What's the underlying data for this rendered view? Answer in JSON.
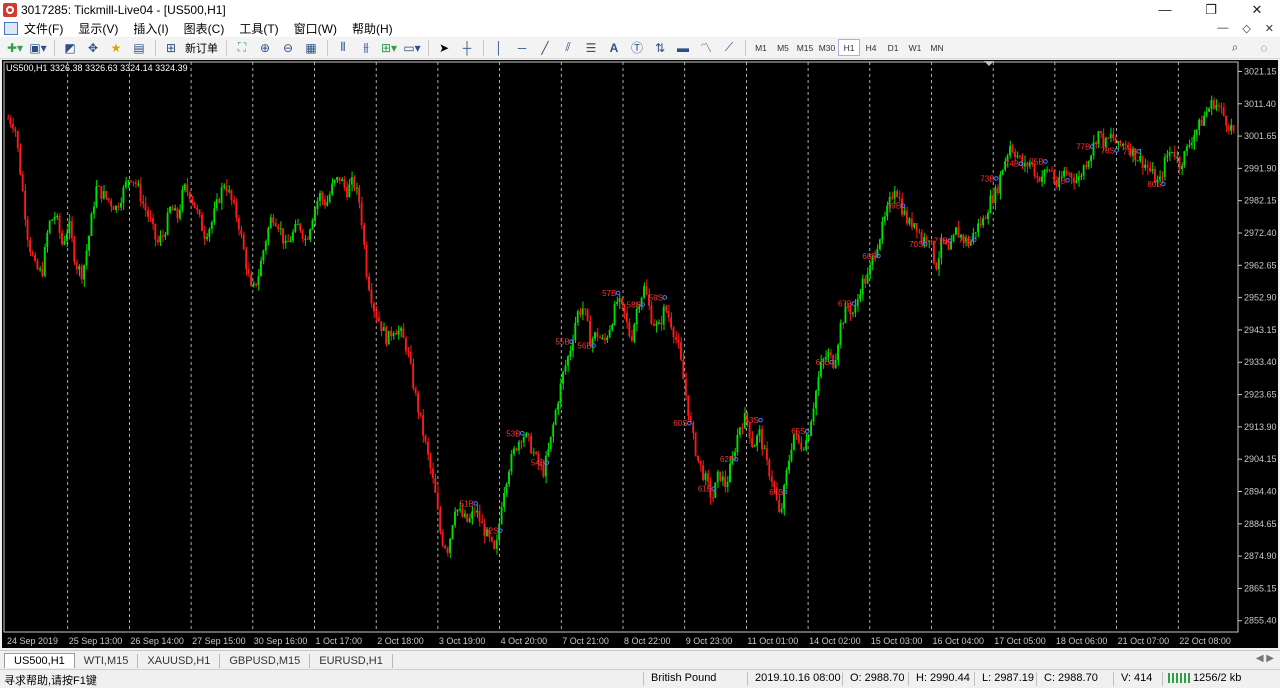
{
  "window": {
    "title": "3017285: Tickmill-Live04 - [US500,H1]",
    "controls": [
      "—",
      "❐",
      "✕"
    ]
  },
  "menu": {
    "items": [
      "文件(F)",
      "显示(V)",
      "插入(I)",
      "图表(C)",
      "工具(T)",
      "窗口(W)",
      "帮助(H)"
    ],
    "right": [
      "—",
      "◇",
      "✕"
    ]
  },
  "toolbar": {
    "new_order_label": "新订单",
    "timeframes": [
      "M1",
      "M5",
      "M15",
      "M30",
      "H1",
      "H4",
      "D1",
      "W1",
      "MN"
    ],
    "active_timeframe": "H1"
  },
  "chart": {
    "symbol_info": "US500,H1  3326.38 3326.63 3324.14 3324.39",
    "colors": {
      "up": "#00e000",
      "down": "#ff1a1a",
      "background": "#000000",
      "axis": "#c8c8c8",
      "marker_text": "#ff3030"
    },
    "price_levels": [
      "3021.15",
      "3011.40",
      "3001.65",
      "2991.90",
      "2982.15",
      "2972.40",
      "2962.65",
      "2952.90",
      "2943.15",
      "2933.40",
      "2923.65",
      "2913.90",
      "2904.15",
      "2894.40",
      "2884.65",
      "2874.90",
      "2865.15",
      "2855.40"
    ],
    "dates": [
      "24 Sep 2019",
      "25 Sep 13:00",
      "26 Sep 14:00",
      "27 Sep 15:00",
      "30 Sep 16:00",
      "1 Oct 17:00",
      "2 Oct 18:00",
      "3 Oct 19:00",
      "4 Oct 20:00",
      "7 Oct 21:00",
      "8 Oct 22:00",
      "9 Oct 23:00",
      "11 Oct 01:00",
      "14 Oct 02:00",
      "15 Oct 03:00",
      "16 Oct 04:00",
      "17 Oct 05:00",
      "18 Oct 06:00",
      "21 Oct 07:00",
      "22 Oct 08:00"
    ],
    "markers": [
      "51B",
      "52S",
      "53B",
      "54B",
      "55B",
      "56B",
      "57B",
      "58S",
      "59S",
      "60S",
      "61B",
      "62B",
      "63S",
      "64B",
      "65S",
      "66B",
      "67B",
      "68S",
      "69B",
      "70S",
      "71B",
      "72S",
      "73B",
      "74B",
      "75B",
      "76B",
      "77B",
      "78S",
      "79S",
      "80S"
    ],
    "series_path": [
      3007,
      3005,
      2988,
      2970,
      2962,
      2960,
      2975,
      2978,
      2969,
      2975,
      2963,
      2960,
      2972,
      2986,
      2984,
      2982,
      2980,
      2985,
      2990,
      2987,
      2981,
      2976,
      2969,
      2972,
      2980,
      2977,
      2986,
      2984,
      2978,
      2972,
      2975,
      2982,
      2988,
      2982,
      2976,
      2965,
      2954,
      2960,
      2970,
      2978,
      2975,
      2968,
      2972,
      2975,
      2970,
      2978,
      2984,
      2981,
      2987,
      2989,
      2985,
      2988,
      2981,
      2960,
      2950,
      2945,
      2940,
      2944,
      2942,
      2937,
      2925,
      2915,
      2905,
      2895,
      2880,
      2877,
      2890,
      2887,
      2885,
      2889,
      2884,
      2880,
      2875,
      2893,
      2902,
      2908,
      2912,
      2909,
      2904,
      2900,
      2908,
      2920,
      2930,
      2937,
      2948,
      2950,
      2940,
      2942,
      2939,
      2945,
      2952,
      2948,
      2940,
      2951,
      2956,
      2947,
      2943,
      2950,
      2945,
      2938,
      2925,
      2912,
      2903,
      2898,
      2892,
      2900,
      2896,
      2904,
      2914,
      2917,
      2908,
      2912,
      2903,
      2897,
      2886,
      2900,
      2912,
      2908,
      2910,
      2921,
      2932,
      2936,
      2933,
      2945,
      2950,
      2948,
      2957,
      2959,
      2967,
      2973,
      2980,
      2987,
      2980,
      2975,
      2976,
      2970,
      2972,
      2962,
      2970,
      2966,
      2973,
      2971,
      2969,
      2974,
      2976,
      2982,
      2985,
      2993,
      2999,
      2996,
      2992,
      2994,
      2989,
      2990,
      2992,
      2986,
      2991,
      2990,
      2988,
      2993,
      2997,
      3003,
      2999,
      3002,
      2998,
      3000,
      2997,
      2995,
      2993,
      2990,
      2987,
      2995,
      2998,
      2993,
      2997,
      3002,
      3005,
      3009,
      3012,
      3010,
      3006,
      3003
    ],
    "price_min": 2852,
    "price_max": 3024
  },
  "tabs": [
    "US500,H1",
    "WTI,M15",
    "XAUUSD,H1",
    "GBPUSD,M15",
    "EURUSD,H1"
  ],
  "active_tab": "US500,H1",
  "status": {
    "help": "寻求帮助,请按F1键",
    "profile": "British Pound",
    "datetime": "2019.10.16 08:00",
    "open": "O: 2988.70",
    "high": "H: 2990.44",
    "low": "L: 2987.19",
    "close": "C: 2988.70",
    "volume": "V: 414",
    "traffic": "1256/2 kb"
  }
}
